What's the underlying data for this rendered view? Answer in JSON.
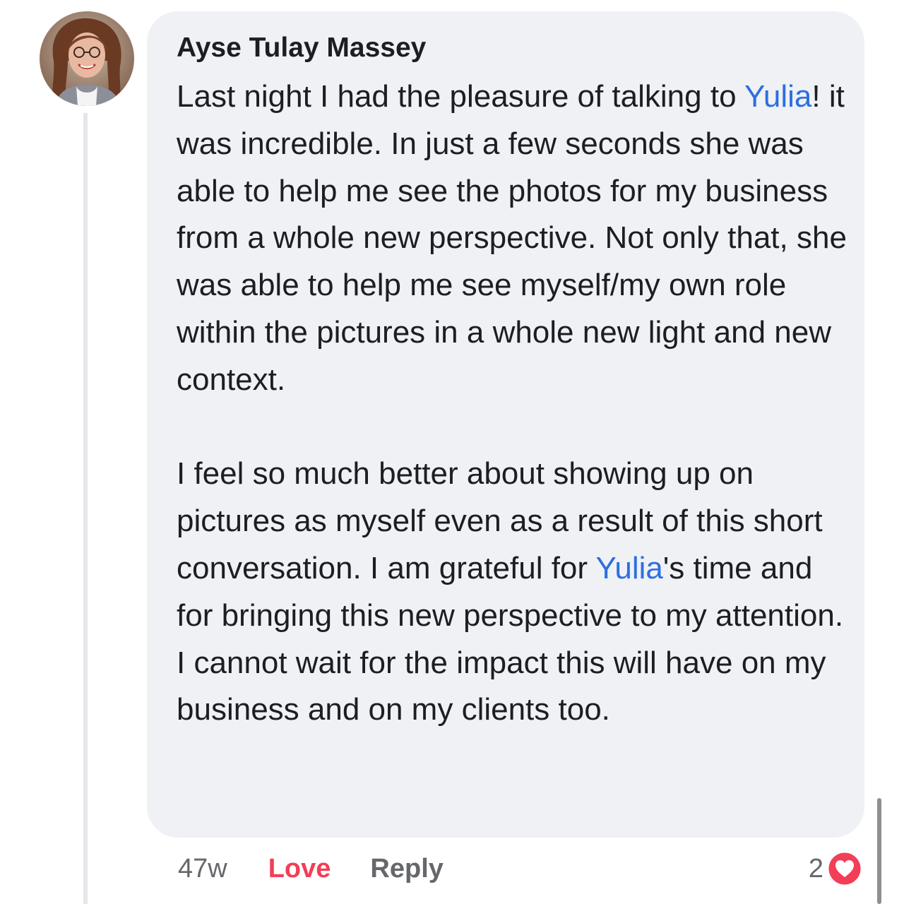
{
  "comment": {
    "author_name": "Ayse Tulay Massey",
    "paragraph1": {
      "part1": "Last night I had the pleasure of talking to ",
      "mention": "Yulia",
      "part2": "! it was incredible. In just a few seconds she was able to help me see the photos for my business from a whole new perspective. Not only that, she was able to help me see myself/my own role within the pictures in a whole new light and new context."
    },
    "paragraph2": {
      "part1": "I feel so much better about showing up on pictures as myself even as a result of this short conversation. I am grateful for ",
      "mention": "Yulia",
      "part2": "'s time and for bringing this new perspective to my attention. I cannot wait for the impact this will have on my business and on my clients too."
    }
  },
  "actions": {
    "timestamp": "47w",
    "love_label": "Love",
    "reply_label": "Reply"
  },
  "reactions": {
    "count": "2",
    "icon": "heart-icon"
  },
  "colors": {
    "bubble_bg": "#f0f1f5",
    "mention": "#2d6fe0",
    "love": "#f33e58",
    "secondary_text": "#65676b"
  }
}
